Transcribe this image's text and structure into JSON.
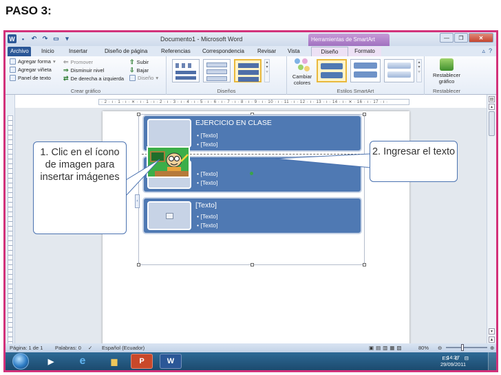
{
  "heading": "PASO 3:",
  "window": {
    "title": "Documento1 - Microsoft Word",
    "contextual_tab": "Herramientas de SmartArt"
  },
  "tabs": {
    "archivo": "Archivo",
    "inicio": "Inicio",
    "insertar": "Insertar",
    "diseno_pagina": "Diseño de página",
    "referencias": "Referencias",
    "correspondencia": "Correspondencia",
    "revisar": "Revisar",
    "vista": "Vista",
    "diseno": "Diseño",
    "formato": "Formato"
  },
  "ribbon": {
    "crear_grafico": {
      "label": "Crear gráfico",
      "agregar_forma": "Agregar forma",
      "agregar_vineta": "Agregar viñeta",
      "panel_texto": "Panel de texto",
      "promover": "Promover",
      "disminuir_nivel": "Disminuir nivel",
      "derecha_izquierda": "De derecha a izquierda",
      "subir": "Subir",
      "bajar": "Bajar",
      "diseno": "Diseño"
    },
    "disenos": {
      "label": "Diseños"
    },
    "estilos": {
      "label": "Estilos SmartArt",
      "cambiar_colores": "Cambiar colores"
    },
    "restablecer": {
      "label": "Restablecer",
      "restablecer_grafico": "Restablecer gráfico"
    }
  },
  "ruler_text": "· 2 · ı · 1 · ı · ✕ · ı · 1 · ı · 2 · ı · 3 · ı · 4 · ı · 5 · ı · 6 · ı · 7 · ı · 8 · ı · 9 · ı · 10 · ı · 11 · ı · 12 · ı · 13 · ı · 14 · ı · ✕ · 16 · ı · 17 · ı ·",
  "smartart": {
    "rows": [
      {
        "title": "EJERCICIO EN CLASE",
        "bullets": [
          "• [Texto]",
          "• [Texto]"
        ]
      },
      {
        "title": "",
        "bullets": [
          "• [Texto]",
          "• [Texto]"
        ]
      },
      {
        "title": "[Texto]",
        "bullets": [
          "• [Texto]",
          "• [Texto]"
        ]
      }
    ]
  },
  "callouts": {
    "one": "1. Clic en el ícono de imagen para insertar imágenes",
    "two": "2. Ingresar el texto"
  },
  "statusbar": {
    "pagina": "Página: 1 de 1",
    "palabras": "Palabras: 0",
    "idioma": "Español (Ecuador)",
    "zoom": "80%"
  },
  "taskbar": {
    "lang": "ES",
    "time": "14:37",
    "date": "29/09/2011"
  },
  "colors": {
    "frame_border": "#d2317a",
    "smartart_fill": "#4f79b3",
    "word_blue": "#2b5797"
  }
}
